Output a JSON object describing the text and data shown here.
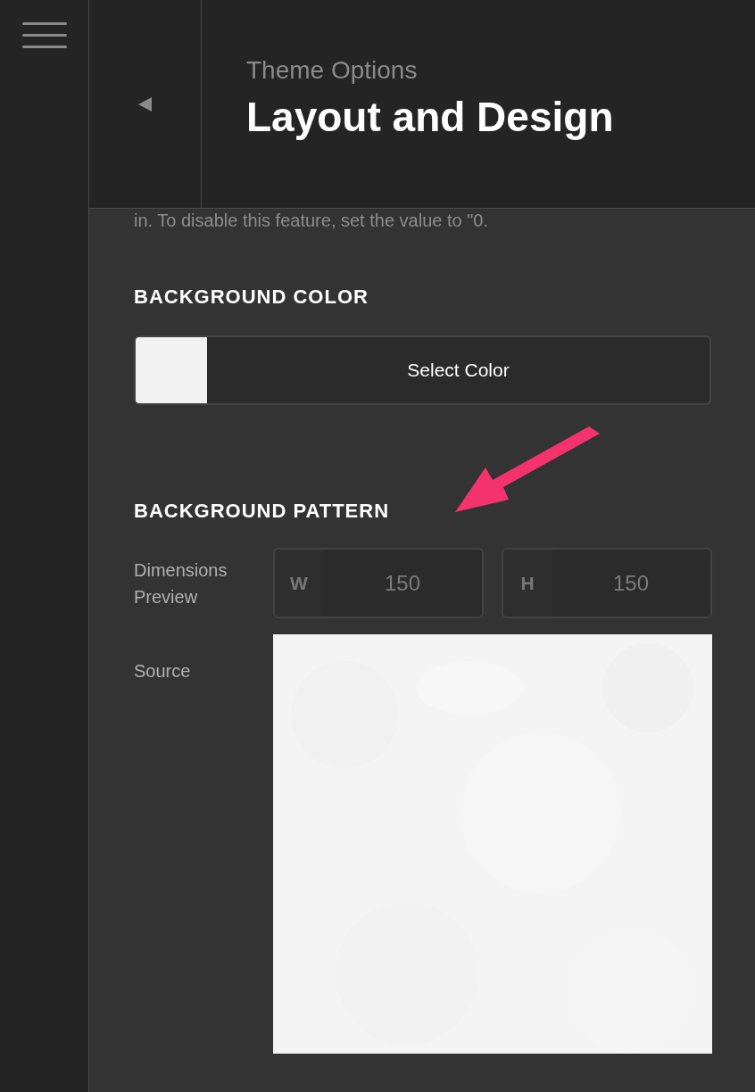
{
  "header": {
    "subtitle": "Theme Options",
    "title": "Layout and Design"
  },
  "intro_text": "in. To disable this feature, set the value to \"0.",
  "background_color": {
    "heading": "BACKGROUND COLOR",
    "button": "Select Color",
    "color": "#f2f2f2"
  },
  "background_pattern": {
    "heading": "BACKGROUND PATTERN",
    "dimensions_label": "Dimensions Preview",
    "fields": [
      {
        "prefix": "W",
        "value": "150"
      },
      {
        "prefix": "H",
        "value": "150"
      }
    ],
    "source_label": "Source"
  }
}
